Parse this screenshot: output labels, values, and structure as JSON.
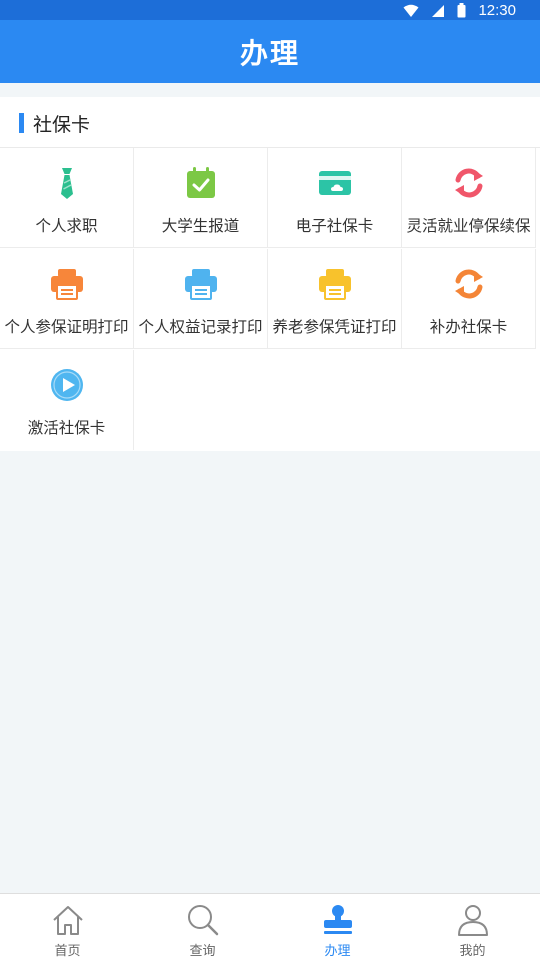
{
  "status": {
    "time": "12:30"
  },
  "header": {
    "title": "办理"
  },
  "section": {
    "title": "社保卡"
  },
  "items": [
    {
      "label": "个人求职",
      "icon": "tie-icon",
      "color": "#2bbf8f"
    },
    {
      "label": "大学生报道",
      "icon": "calendar-check-icon",
      "color": "#7cc845"
    },
    {
      "label": "电子社保卡",
      "icon": "card-icon",
      "color": "#2cc4a6"
    },
    {
      "label": "灵活就业停保续保",
      "icon": "refresh-icon",
      "color": "#f0566a"
    },
    {
      "label": "个人参保证明打印",
      "icon": "printer-icon",
      "color": "#f7863a"
    },
    {
      "label": "个人权益记录打印",
      "icon": "printer-icon",
      "color": "#4fb3ef"
    },
    {
      "label": "养老参保凭证打印",
      "icon": "printer-icon",
      "color": "#f8c22c"
    },
    {
      "label": "补办社保卡",
      "icon": "refresh-icon",
      "color": "#f48537"
    },
    {
      "label": "激活社保卡",
      "icon": "play-icon",
      "color": "#4fb6f0"
    }
  ],
  "tabs": [
    {
      "label": "首页",
      "icon": "home-icon",
      "active": false
    },
    {
      "label": "查询",
      "icon": "search-icon",
      "active": false
    },
    {
      "label": "办理",
      "icon": "stamp-icon",
      "active": true
    },
    {
      "label": "我的",
      "icon": "user-icon",
      "active": false
    }
  ],
  "colors": {
    "primary": "#2b89f2",
    "statusbar": "#1d6ed8",
    "background": "#f2f6f8"
  }
}
